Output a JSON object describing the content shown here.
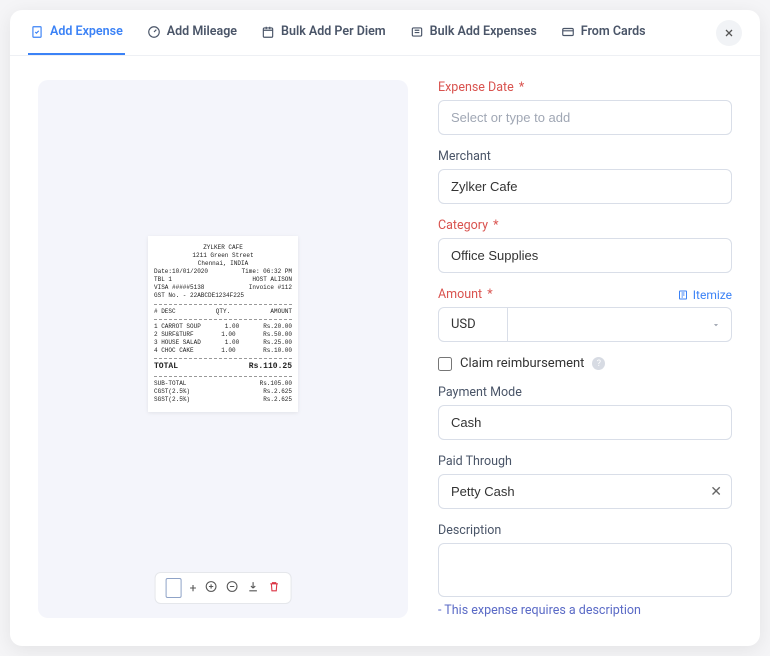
{
  "tabs": [
    {
      "label": "Add Expense",
      "active": true
    },
    {
      "label": "Add Mileage"
    },
    {
      "label": "Bulk Add Per Diem"
    },
    {
      "label": "Bulk Add Expenses"
    },
    {
      "label": "From Cards"
    }
  ],
  "receipt": {
    "name": "ZYLKER CAFE",
    "addr1": "1211 Green Street",
    "addr2": "Chennai, INDIA",
    "date_l": "Date:10/01/2020",
    "date_r": "Time: 06:32 PM",
    "tbl_l": "TBL 1",
    "tbl_r": "HOST ALISON",
    "visa_l": "VISA #####5138",
    "visa_r": "Invoice #112",
    "gst": "GST No. - 22ABCDE1234F225",
    "head_l": "# DESC",
    "head_m": "QTY.",
    "head_r": "AMOUNT",
    "items": [
      {
        "d": "1 CARROT SOUP",
        "q": "1.00",
        "a": "Rs.20.00"
      },
      {
        "d": "2 SURF&TURF",
        "q": "1.00",
        "a": "Rs.50.00"
      },
      {
        "d": "3 HOUSE SALAD",
        "q": "1.00",
        "a": "Rs.25.00"
      },
      {
        "d": "4 CHOC CAKE",
        "q": "1.00",
        "a": "Rs.10.00"
      }
    ],
    "total_l": "TOTAL",
    "total_r": "Rs.110.25",
    "sub_l": "SUB-TOTAL",
    "sub_r": "Rs.105.00",
    "cgst_l": "CGST(2.5%)",
    "cgst_r": "Rs.2.625",
    "sgst_l": "SGST(2.5%)",
    "sgst_r": "Rs.2.625"
  },
  "form": {
    "date_label": "Expense Date",
    "date_placeholder": "Select or type to add",
    "merchant_label": "Merchant",
    "merchant_value": "Zylker Cafe",
    "category_label": "Category",
    "category_value": "Office Supplies",
    "amount_label": "Amount",
    "itemize": "Itemize",
    "currency": "USD",
    "claim": "Claim reimbursement",
    "payment_label": "Payment Mode",
    "payment_value": "Cash",
    "paid_label": "Paid Through",
    "paid_value": "Petty Cash",
    "desc_label": "Description",
    "note": "- This expense requires a description"
  },
  "toolbar": {
    "add": "+"
  }
}
